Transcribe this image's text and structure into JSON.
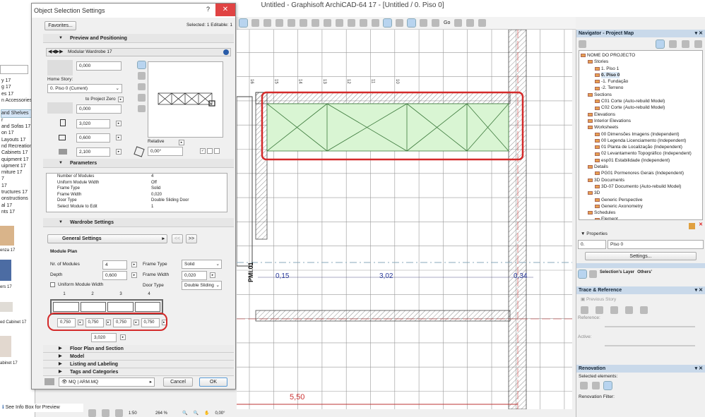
{
  "window": {
    "title": "Untitled - Graphisoft ArchiCAD-64 17 - [Untitled / 0. Piso 0]"
  },
  "library": {
    "items": [
      "y 17",
      "g 17",
      "es 17",
      "n Accessories",
      "",
      "and Shelves",
      "r",
      "and Sofas 17",
      "on 17",
      "Layouts 17",
      "nd Recreation",
      "Cabinets 17",
      "quipment 17",
      "uipment 17",
      "rniture 17",
      "7",
      "17",
      "tructures 17",
      "onstructions",
      "al 17",
      "nts 17"
    ],
    "selected_index": 5,
    "thumbs": [
      "enza 17",
      "ers 17",
      "ed Cabinet 17",
      "abinet 17"
    ],
    "info": "See Info Box for Preview"
  },
  "dialog": {
    "title": "Object Selection Settings",
    "help": "?",
    "close": "✕",
    "favorites": "Favorites...",
    "selected_info": "Selected: 1 Editable: 1",
    "preview": {
      "section": "Preview and Positioning",
      "object_name": "Modular Wardrobe 17",
      "elevation": "0,000",
      "home_story_label": "Home Story:",
      "home_story": "0. Piso 0 (Current)",
      "to_project_zero": "to Project Zero",
      "project_zero": "0,000",
      "width": "3,020",
      "depth": "0,600",
      "height": "2,100",
      "relative": "Relative",
      "angle": "0,00°"
    },
    "parameters": {
      "section": "Parameters",
      "rows": [
        [
          "Number of Modules",
          "4"
        ],
        [
          "Uniform Module Width",
          "Off"
        ],
        [
          "Frame Type",
          "Solid"
        ],
        [
          "Frame Width",
          "0,020"
        ],
        [
          "Door Type",
          "Double Sliding Door"
        ],
        [
          "Select Module to Edit",
          "1"
        ]
      ]
    },
    "wardrobe": {
      "section": "Wardrobe Settings",
      "page": "General Settings",
      "prev": "<<",
      "next": ">>",
      "module_plan": "Module Plan",
      "nr_modules_label": "Nr. of Modules",
      "nr_modules": "4",
      "depth_label": "Depth",
      "depth": "0,600",
      "uniform_label": "Uniform Module Width",
      "uniform_checked": false,
      "frame_type_label": "Frame Type",
      "frame_type": "Solid",
      "frame_width_label": "Frame Width",
      "frame_width": "0,020",
      "door_type_label": "Door Type",
      "door_type": "Double Sliding",
      "module_numbers": [
        "1",
        "2",
        "3",
        "4"
      ],
      "module_widths": [
        "0,750",
        "0,750",
        "0,750",
        "0,750"
      ],
      "total_width": "3,020"
    },
    "collapsed_sections": [
      "Floor Plan and Section",
      "Model",
      "Listing and Labeling",
      "Tags and Categories"
    ],
    "layer": "MQ | ARM.MQ",
    "cancel": "Cancel",
    "ok": "OK"
  },
  "canvas": {
    "ruler_numbers": [
      "16",
      "15",
      "14",
      "13",
      "12",
      "11",
      "10"
    ],
    "dims": [
      "0,15",
      "3,02",
      "0,34"
    ],
    "marker": "PMi.01",
    "overall_dim": "5,50",
    "highlight_color": "#d42a2a",
    "object_fill": "#d9f5d3"
  },
  "toolbar": {
    "go": "Go"
  },
  "navigator": {
    "title": "Navigator - Project Map",
    "tree": [
      {
        "t": "NOME DO PROJECTO",
        "l": 0
      },
      {
        "t": "Stories",
        "l": 1
      },
      {
        "t": "1. Piso 1",
        "l": 2
      },
      {
        "t": "0. Piso 0",
        "l": 2,
        "sel": true
      },
      {
        "t": "-1. Fundação",
        "l": 2
      },
      {
        "t": "-2. Terreno",
        "l": 2
      },
      {
        "t": "Sections",
        "l": 1
      },
      {
        "t": "C01 Corte (Auto-rebuild Model)",
        "l": 2
      },
      {
        "t": "C02 Corte (Auto-rebuild Model)",
        "l": 2
      },
      {
        "t": "Elevations",
        "l": 1
      },
      {
        "t": "Interior Elevations",
        "l": 1
      },
      {
        "t": "Worksheets",
        "l": 1
      },
      {
        "t": "00 Dimensões Imagens (Independent)",
        "l": 2
      },
      {
        "t": "00 Legenda Licenciamento (Independent)",
        "l": 2
      },
      {
        "t": "01 Planta de Localização (Independent)",
        "l": 2
      },
      {
        "t": "02 Levantamento Topográfico (Independent)",
        "l": 2
      },
      {
        "t": "esp01 Estabilidade (Independent)",
        "l": 2
      },
      {
        "t": "Details",
        "l": 1
      },
      {
        "t": "PG01 Pormenores Gerais (Independent)",
        "l": 2
      },
      {
        "t": "3D Documents",
        "l": 1
      },
      {
        "t": "3D-07 Documento (Auto-rebuild Model)",
        "l": 2
      },
      {
        "t": "3D",
        "l": 1
      },
      {
        "t": "Generic Perspective",
        "l": 2
      },
      {
        "t": "Generic Axonometry",
        "l": 2
      },
      {
        "t": "Schedules",
        "l": 1
      },
      {
        "t": "Element",
        "l": 2
      }
    ],
    "properties": "Properties",
    "prop_id": "0.",
    "prop_name": "Piso 0",
    "settings": "Settings..."
  },
  "layers": {
    "selections_layer": "Selection's Layer",
    "others": "Others'"
  },
  "trace": {
    "title": "Trace & Reference",
    "previous": "Previous Story",
    "reference": "Reference:",
    "active": "Active:"
  },
  "renovation": {
    "title": "Renovation",
    "selected": "Selected elements:",
    "filter": "Renovation Filter:"
  },
  "status": {
    "scale": "1:50",
    "zoom": "264 %",
    "angle": "0,00°"
  }
}
